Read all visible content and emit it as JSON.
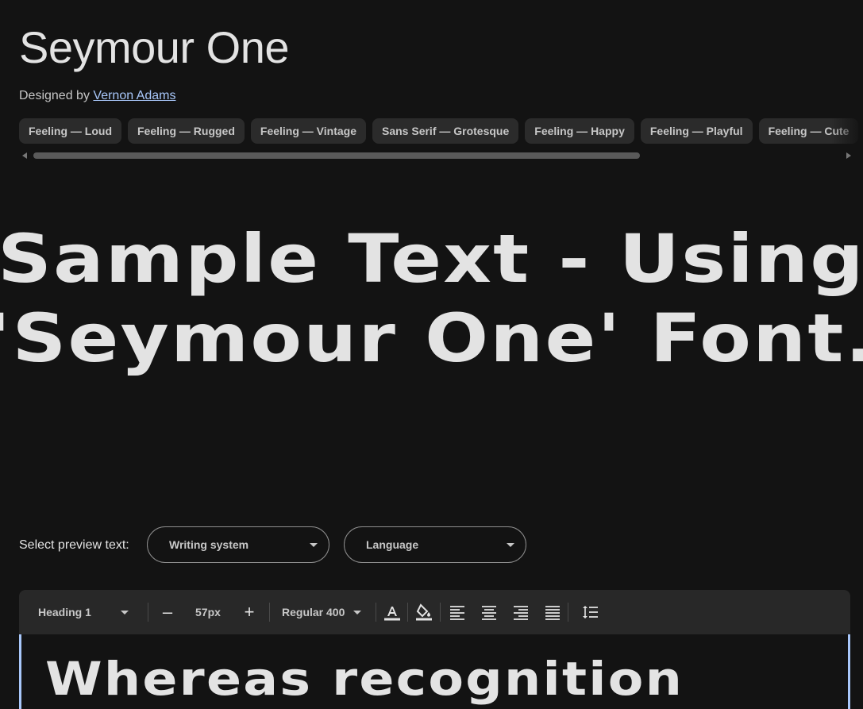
{
  "font": {
    "title": "Seymour One",
    "designed_by_label": "Designed by",
    "designer": "Vernon Adams"
  },
  "tags": [
    "Feeling — Loud",
    "Feeling — Rugged",
    "Feeling — Vintage",
    "Sans Serif — Grotesque",
    "Feeling — Happy",
    "Feeling — Playful",
    "Feeling — Cute"
  ],
  "sample_text": "Sample Text - Using 'Seymour One' Font.",
  "preview": {
    "label": "Select preview text:",
    "writing_system": "Writing system",
    "language": "Language"
  },
  "toolbar": {
    "style": "Heading 1",
    "minus": "–",
    "size": "57px",
    "plus": "+",
    "weight": "Regular 400"
  },
  "editor_text": "Whereas recognition",
  "colors": {
    "background": "#131313",
    "link": "#a8c7fa",
    "chip": "#2b2b2b",
    "toolbar": "#282828"
  }
}
